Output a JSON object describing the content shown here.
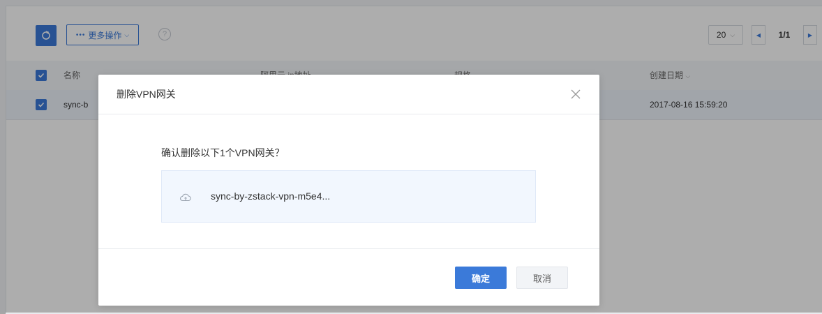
{
  "toolbar": {
    "more_actions_label": "更多操作",
    "help_label": "?",
    "page_size": "20",
    "page_info": "1/1"
  },
  "table": {
    "columns": [
      "名称",
      "阿里云 ip地址",
      "规格",
      "创建日期"
    ],
    "rows": [
      {
        "name": "sync-b",
        "created": "2017-08-16 15:59:20"
      }
    ]
  },
  "dialog": {
    "title": "删除VPN网关",
    "message": "确认删除以下1个VPN网关？",
    "item_name": "sync-by-zstack-vpn-m5e4...",
    "confirm_label": "确定",
    "cancel_label": "取消"
  },
  "colors": {
    "accent": "#3b7ad9",
    "overlay": "rgba(0,0,0,0.32)"
  },
  "icons": {
    "refresh": "refresh-icon",
    "more": "ellipsis-icon",
    "close": "close-icon",
    "item": "cloud-icon"
  }
}
